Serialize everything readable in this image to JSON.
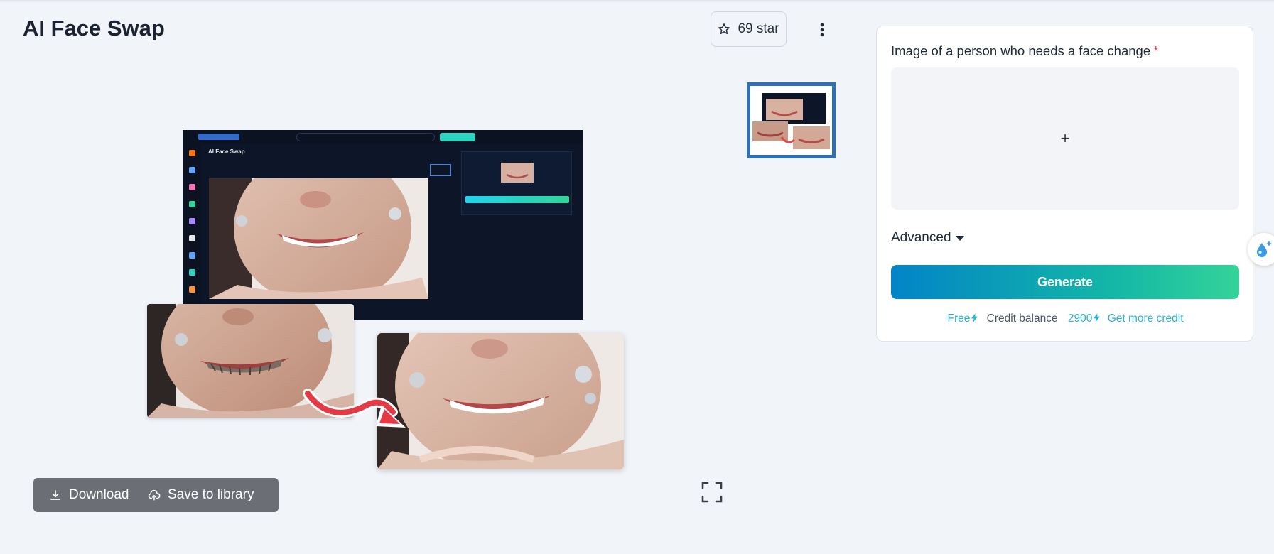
{
  "page": {
    "title": "AI Face Swap"
  },
  "header": {
    "star_label": "69 star"
  },
  "preview_app": {
    "title": "AI Face Swap"
  },
  "actions": {
    "download_label": "Download",
    "save_label": "Save to library"
  },
  "form": {
    "field_label": "Image of a person who needs a face change",
    "required_mark": "*",
    "upload_plus": "+",
    "advanced_label": "Advanced",
    "generate_label": "Generate"
  },
  "credit": {
    "free_label": "Free",
    "balance_label": "Credit balance",
    "balance_value": "2900",
    "more_link": "Get more credit"
  },
  "colors": {
    "accent": "#2ab3d6",
    "generate_from": "#0284c7",
    "generate_to": "#34d399",
    "thumb_border": "#2f6fb3",
    "required": "#e5484d"
  },
  "icons": [
    "star-icon",
    "more-vertical-icon",
    "download-icon",
    "cloud-upload-icon",
    "fullscreen-icon",
    "plus-icon",
    "caret-down-icon",
    "lightning-icon",
    "water-drop-icon"
  ]
}
